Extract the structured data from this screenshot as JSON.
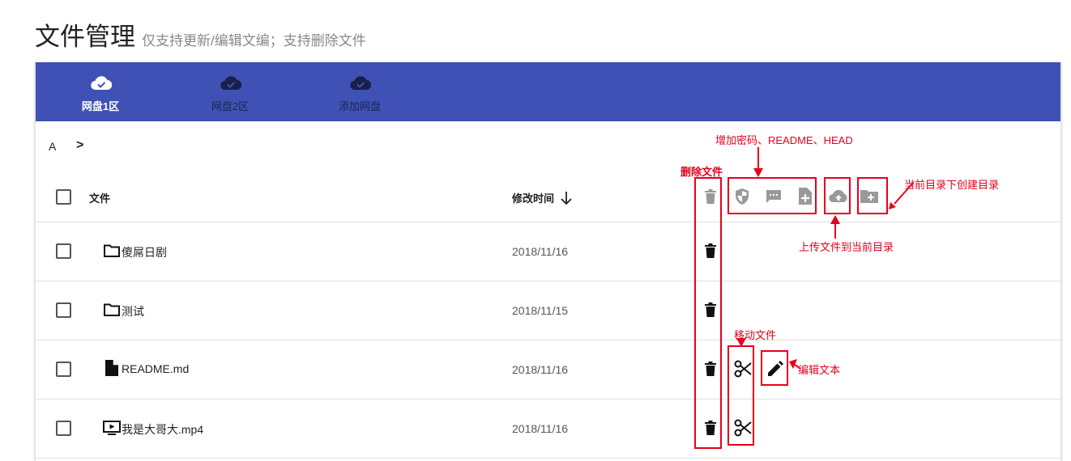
{
  "page": {
    "title": "文件管理",
    "subtitle": "仅支持更新/编辑文编；支持删除文件"
  },
  "colors": {
    "tabbar": "#3f51b5",
    "annotation": "#e5001c"
  },
  "tabs": [
    {
      "label": "网盘1区",
      "icon": "cloud-check-icon",
      "active": true
    },
    {
      "label": "网盘2区",
      "icon": "cloud-check-icon",
      "active": false
    },
    {
      "label": "添加网盘",
      "icon": "cloud-check-icon",
      "active": false
    }
  ],
  "breadcrumb": {
    "current": "A",
    "separator": ">"
  },
  "table": {
    "columns": {
      "name": "文件",
      "modified": "修改时间",
      "sort_icon": "arrow-down-icon"
    },
    "rows": [
      {
        "name": "傻屌日剧",
        "date": "2018/11/16",
        "type_icon": "folder-icon"
      },
      {
        "name": "测试",
        "date": "2018/11/15",
        "type_icon": "folder-icon"
      },
      {
        "name": "README.md",
        "date": "2018/11/16",
        "type_icon": "file-icon"
      },
      {
        "name": "我是大哥大.mp4",
        "date": "2018/11/16",
        "type_icon": "video-icon"
      }
    ]
  },
  "toolbar_icons": [
    "delete-icon",
    "password-shield-icon",
    "readme-message-icon",
    "head-file-add-icon",
    "upload-cloud-icon",
    "create-folder-icon"
  ],
  "annotations": {
    "delete_files": "删除文件",
    "add_password": "增加密码、README、HEAD",
    "create_dir": "当前目录下创建目录",
    "upload_file": "上传文件到当前目录",
    "move_file": "移动文件",
    "edit_text": "编辑文本"
  }
}
